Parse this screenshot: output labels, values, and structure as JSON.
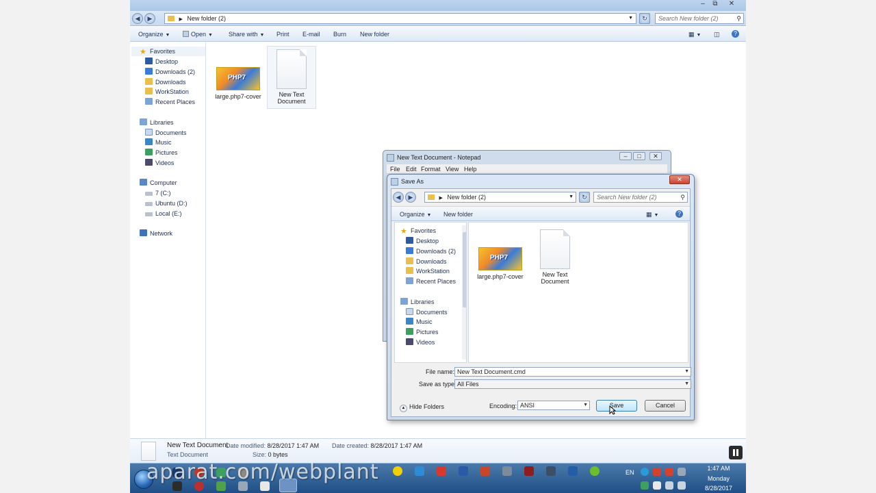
{
  "explorer": {
    "address": "New folder (2)",
    "search_placeholder": "Search New folder (2)",
    "commands": {
      "organize": "Organize",
      "open": "Open",
      "share_with": "Share with",
      "print": "Print",
      "email": "E-mail",
      "burn": "Burn",
      "new_folder": "New folder"
    },
    "nav": {
      "favorites": "Favorites",
      "desktop": "Desktop",
      "downloads2": "Downloads (2)",
      "downloads": "Downloads",
      "workstation": "WorkStation",
      "recent": "Recent Places",
      "libraries": "Libraries",
      "documents": "Documents",
      "music": "Music",
      "pictures": "Pictures",
      "videos": "Videos",
      "computer": "Computer",
      "drive_c": "7 (C:)",
      "drive_d": "Ubuntu (D:)",
      "drive_e": "Local (E:)",
      "network": "Network"
    },
    "files": [
      {
        "name": "large.php7-cover",
        "type": "image"
      },
      {
        "name": "New Text Document",
        "type": "text"
      }
    ],
    "details": {
      "name": "New Text Document",
      "type": "Text Document",
      "modified_label": "Date modified:",
      "modified_value": "8/28/2017 1:47 AM",
      "size_label": "Size:",
      "size_value": "0 bytes",
      "created_label": "Date created:",
      "created_value": "8/28/2017 1:47 AM"
    }
  },
  "notepad": {
    "title": "New Text Document - Notepad",
    "menu": {
      "file": "File",
      "edit": "Edit",
      "format": "Format",
      "view": "View",
      "help": "Help"
    }
  },
  "save_as": {
    "title": "Save As",
    "address": "New folder (2)",
    "search_placeholder": "Search New folder (2)",
    "organize": "Organize",
    "new_folder": "New folder",
    "nav": {
      "favorites": "Favorites",
      "desktop": "Desktop",
      "downloads2": "Downloads (2)",
      "downloads": "Downloads",
      "workstation": "WorkStation",
      "recent": "Recent Places",
      "libraries": "Libraries",
      "documents": "Documents",
      "music": "Music",
      "pictures": "Pictures",
      "videos": "Videos"
    },
    "files": [
      {
        "name": "large.php7-cover"
      },
      {
        "name_line1": "New Text",
        "name_line2": "Document"
      }
    ],
    "file_name_label": "File name:",
    "file_name_value": "New Text Document.cmd",
    "save_type_label": "Save as type:",
    "save_type_value": "All Files",
    "hide_folders": "Hide Folders",
    "encoding_label": "Encoding:",
    "encoding_value": "ANSI",
    "save": "Save",
    "cancel": "Cancel"
  },
  "taskbar": {
    "lang": "EN",
    "time": "1:47 AM",
    "day": "Monday",
    "date": "8/28/2017",
    "watermark": "aparat.com/webplant"
  },
  "thumb_text": "PHP7",
  "colors": {
    "accent": "#3c7fb1",
    "taskbar": "#1f4f86"
  }
}
